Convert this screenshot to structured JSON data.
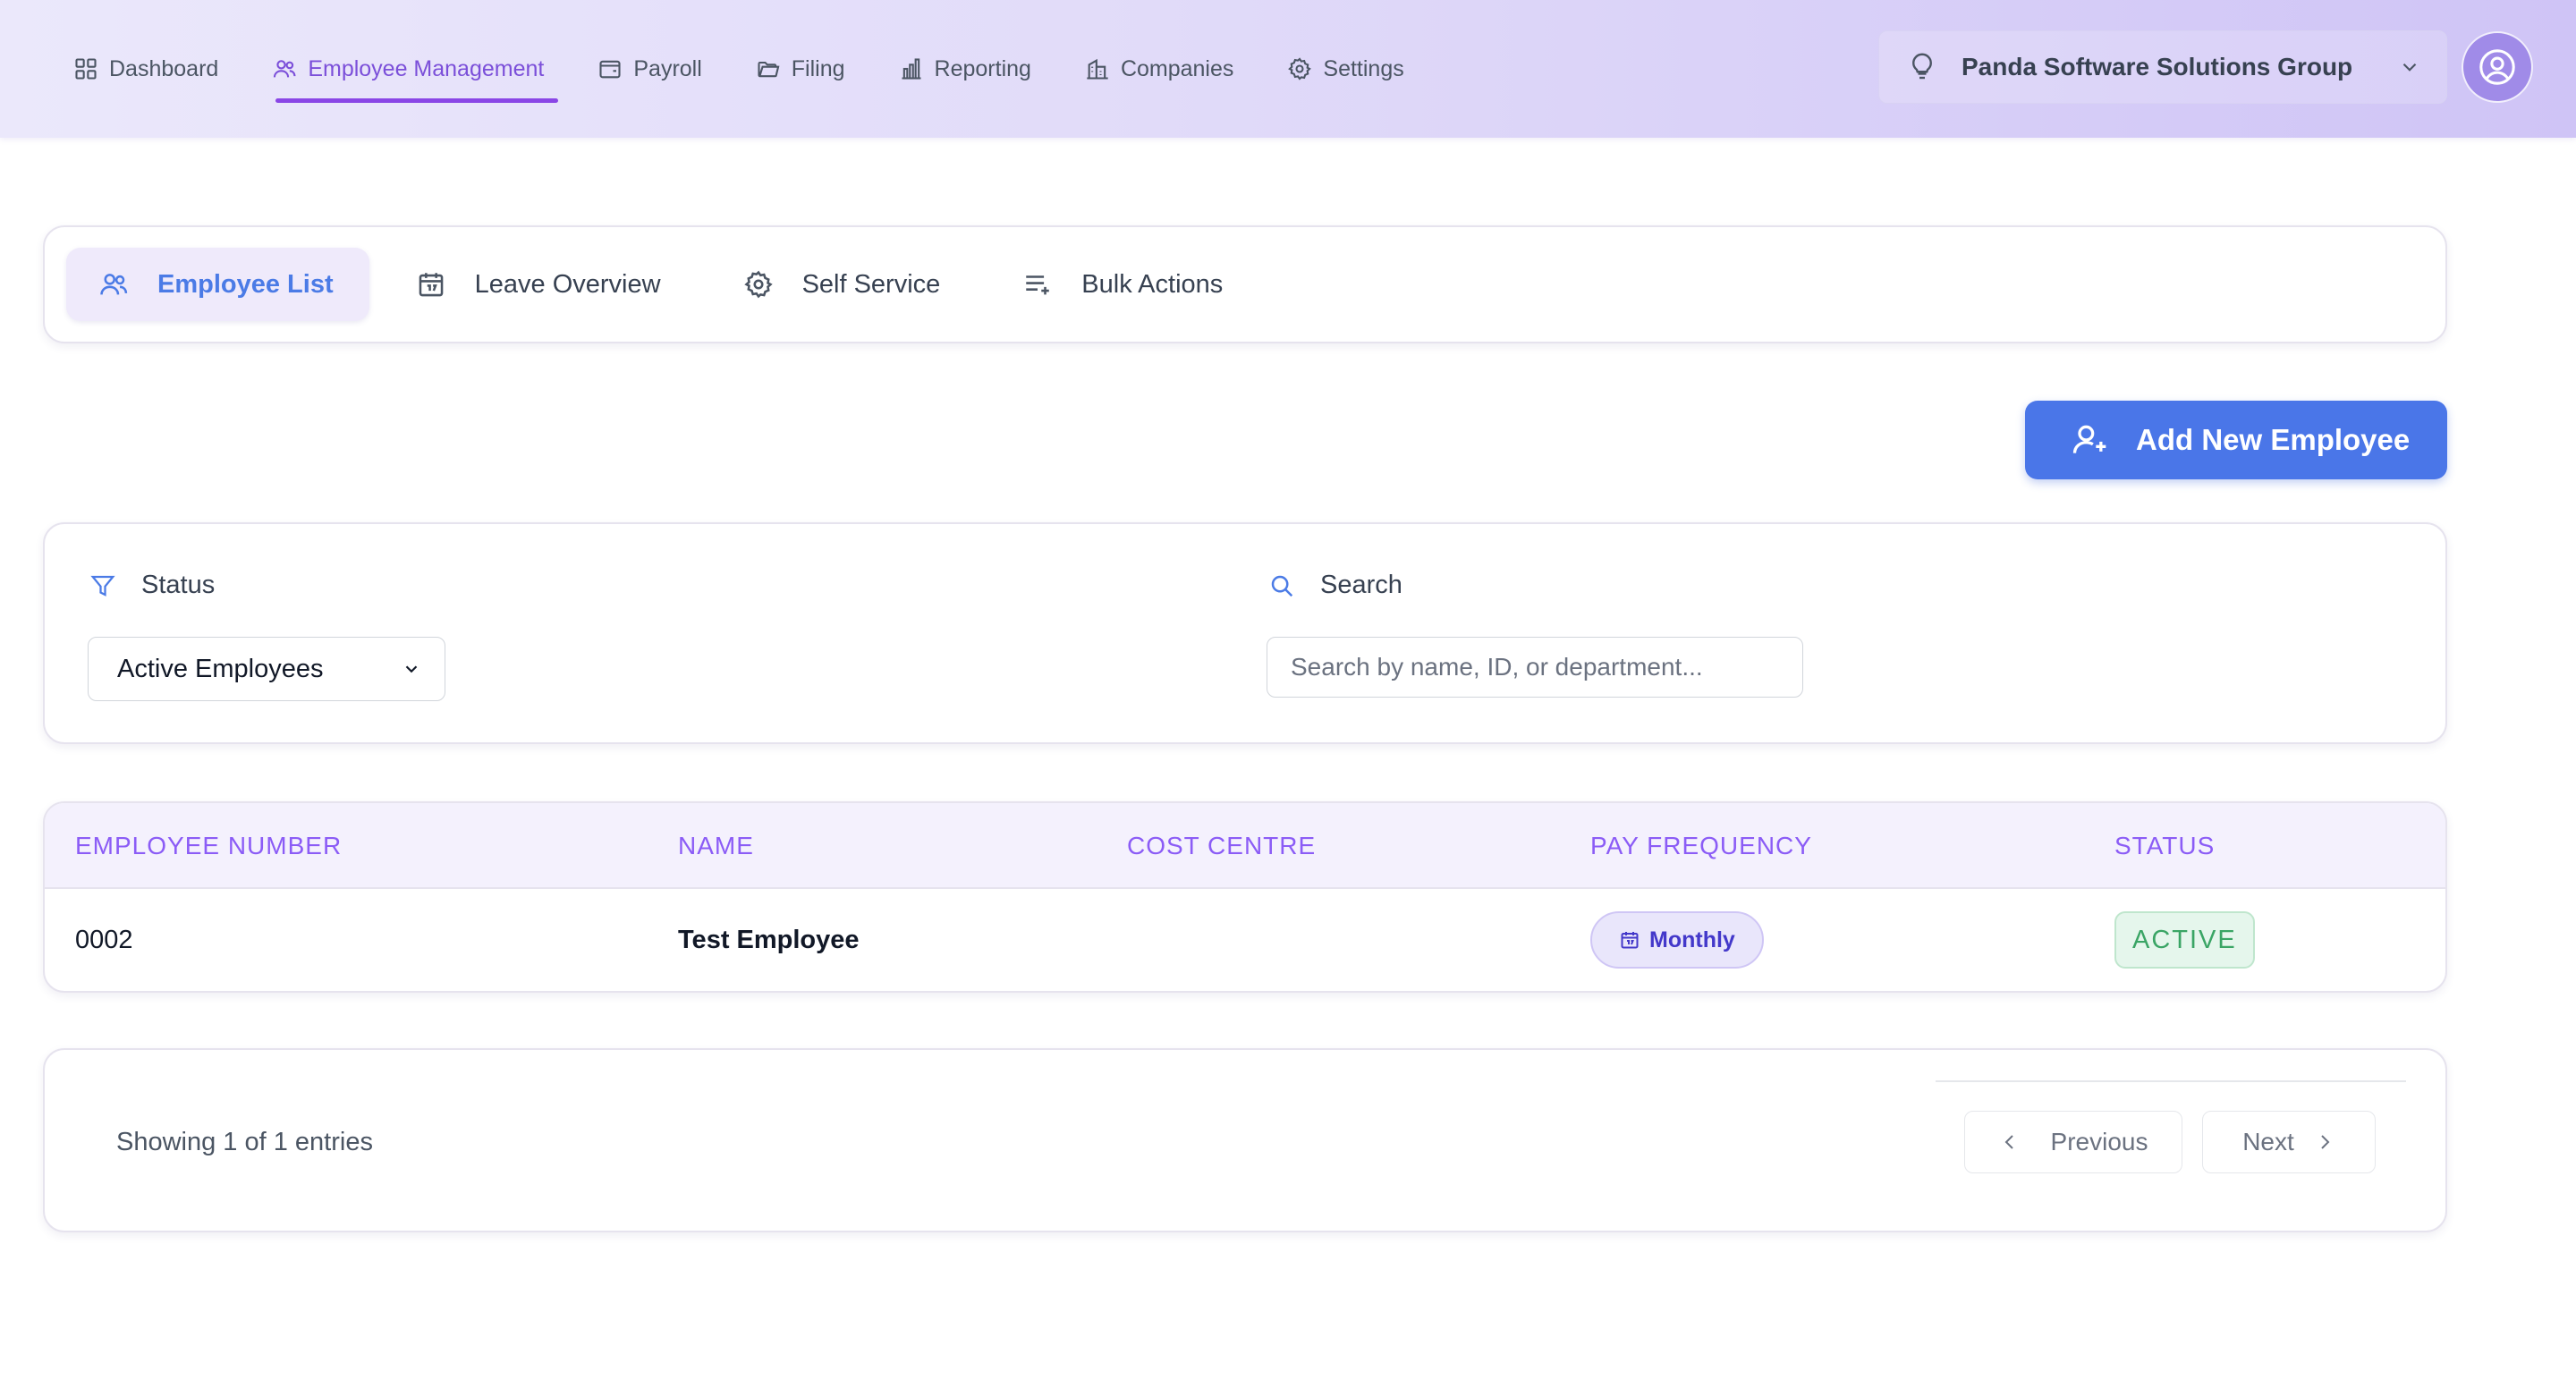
{
  "nav": {
    "items": [
      {
        "label": "Dashboard",
        "icon": "grid-icon"
      },
      {
        "label": "Employee Management",
        "icon": "users-icon",
        "active": true
      },
      {
        "label": "Payroll",
        "icon": "wallet-icon"
      },
      {
        "label": "Filing",
        "icon": "folder-icon"
      },
      {
        "label": "Reporting",
        "icon": "bar-chart-icon"
      },
      {
        "label": "Companies",
        "icon": "building-icon"
      },
      {
        "label": "Settings",
        "icon": "gear-icon"
      }
    ],
    "company": "Panda Software Solutions Group"
  },
  "subtabs": [
    {
      "label": "Employee List",
      "icon": "users-icon",
      "active": true
    },
    {
      "label": "Leave Overview",
      "icon": "calendar-icon"
    },
    {
      "label": "Self Service",
      "icon": "gear-icon"
    },
    {
      "label": "Bulk Actions",
      "icon": "list-plus-icon"
    }
  ],
  "actions": {
    "add_employee": "Add New Employee"
  },
  "filters": {
    "status_label": "Status",
    "status_value": "Active Employees",
    "search_label": "Search",
    "search_placeholder": "Search by name, ID, or department..."
  },
  "table": {
    "columns": [
      "EMPLOYEE NUMBER",
      "NAME",
      "COST CENTRE",
      "PAY FREQUENCY",
      "STATUS"
    ],
    "rows": [
      {
        "employee_number": "0002",
        "name": "Test Employee",
        "cost_centre": "",
        "pay_frequency": "Monthly",
        "status": "ACTIVE"
      }
    ]
  },
  "pagination": {
    "showing": "Showing 1 of 1 entries",
    "previous": "Previous",
    "next": "Next"
  },
  "colors": {
    "accent": "#8b5cf6",
    "primary_button": "#4a76e8",
    "active_badge": "#3aa565",
    "nav_active": "#7b4fd9"
  }
}
